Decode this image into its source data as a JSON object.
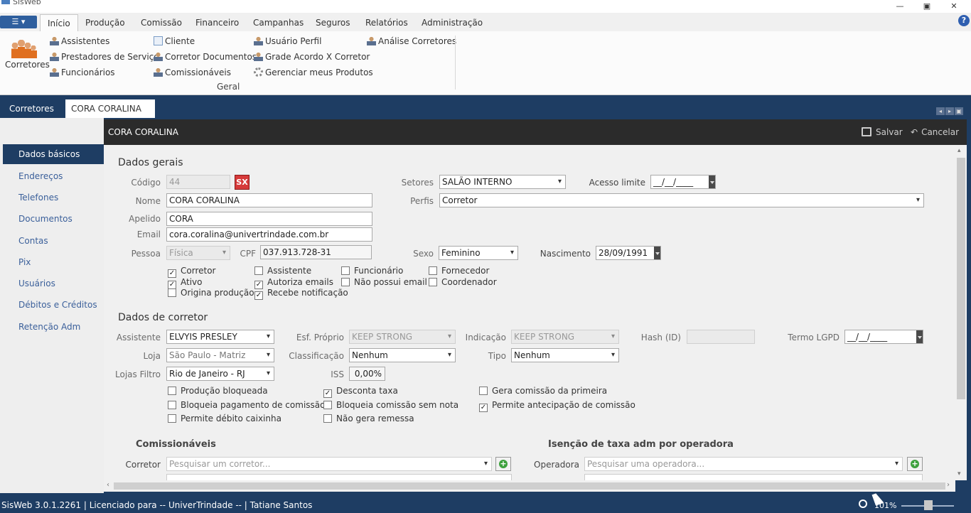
{
  "window": {
    "title": "SisWeb",
    "min": "—",
    "restore": "▣",
    "close": "✕"
  },
  "menu": {
    "app_button": "☰ ▾",
    "tabs": [
      "Início",
      "Produção",
      "Comissão",
      "Financeiro",
      "Campanhas",
      "Seguros",
      "Relatórios",
      "Administração"
    ],
    "help": "?"
  },
  "ribbon": {
    "big": {
      "label": "Corretores"
    },
    "col1": [
      "Assistentes",
      "Prestadores de Serviço",
      "Funcionários"
    ],
    "col2": [
      "Cliente",
      "Corretor Documentos",
      "Comissionáveis"
    ],
    "col3": [
      "Usuário Perfil",
      "Grade Acordo X Corretor",
      "Gerenciar meus Produtos"
    ],
    "col4": [
      "Análise Corretores"
    ],
    "group_label": "Geral"
  },
  "doc_tabs": [
    "Corretores",
    "CORA CORALINA"
  ],
  "sidebar": [
    "Dados básicos",
    "Endereços",
    "Telefones",
    "Documentos",
    "Contas",
    "Pix",
    "Usuários",
    "Débitos e Créditos",
    "Retenção Adm"
  ],
  "header": {
    "title": "CORA CORALINA",
    "save": "Salvar",
    "cancel": "Cancelar"
  },
  "dados_gerais": {
    "title": "Dados gerais",
    "codigo_label": "Código",
    "codigo": "44",
    "sx": "SX",
    "nome_label": "Nome",
    "nome": "CORA CORALINA",
    "apelido_label": "Apelido",
    "apelido": "CORA",
    "email_label": "Email",
    "email": "cora.coralina@univertrindade.com.br",
    "pessoa_label": "Pessoa",
    "pessoa": "Física",
    "cpf_label": "CPF",
    "cpf": "037.913.728-31",
    "setores_label": "Setores",
    "setores": "SALÃO INTERNO",
    "perfis_label": "Perfis",
    "perfis": "Corretor",
    "acesso_label": "Acesso limite",
    "acesso": "__/__/____",
    "sexo_label": "Sexo",
    "sexo": "Feminino",
    "nasc_label": "Nascimento",
    "nasc": "28/09/1991",
    "checks": [
      {
        "label": "Corretor",
        "checked": true
      },
      {
        "label": "Ativo",
        "checked": true
      },
      {
        "label": "Origina produção",
        "checked": false
      },
      {
        "label": "Assistente",
        "checked": false
      },
      {
        "label": "Autoriza emails",
        "checked": true
      },
      {
        "label": "Recebe notificação",
        "checked": true
      },
      {
        "label": "Funcionário",
        "checked": false
      },
      {
        "label": "Não possui email",
        "checked": false
      },
      {
        "label": "Fornecedor",
        "checked": false
      },
      {
        "label": "Coordenador",
        "checked": false
      }
    ]
  },
  "dados_corretor": {
    "title": "Dados de corretor",
    "assistente_label": "Assistente",
    "assistente": "ELVYIS PRESLEY",
    "loja_label": "Loja",
    "loja": "São Paulo - Matriz",
    "lojas_label": "Lojas Filtro",
    "lojas": "Rio de Janeiro - RJ",
    "esf_label": "Esf. Próprio",
    "esf": "KEEP STRONG",
    "class_label": "Classificação",
    "class": "Nenhum",
    "iss_label": "ISS",
    "iss": "0,00%",
    "ind_label": "Indicação",
    "ind": "KEEP STRONG",
    "tipo_label": "Tipo",
    "tipo": "Nenhum",
    "hash_label": "Hash (ID)",
    "hash": "",
    "lgpd_label": "Termo LGPD",
    "lgpd": "__/__/____",
    "checks": [
      {
        "label": "Produção bloqueada",
        "checked": false
      },
      {
        "label": "Bloqueia pagamento de comissão",
        "checked": false
      },
      {
        "label": "Permite débito caixinha",
        "checked": false
      },
      {
        "label": "Desconta taxa",
        "checked": true
      },
      {
        "label": "Bloqueia comissão sem nota",
        "checked": false
      },
      {
        "label": "Não gera remessa",
        "checked": false
      },
      {
        "label": "Gera comissão da primeira",
        "checked": false
      },
      {
        "label": "Permite antecipação de comissão",
        "checked": true
      }
    ]
  },
  "comissionaveis": {
    "title": "Comissionáveis",
    "label": "Corretor",
    "placeholder": "Pesquisar um corretor..."
  },
  "isencao": {
    "title": "Isenção de taxa adm por operadora",
    "label": "Operadora",
    "placeholder": "Pesquisar uma operadora..."
  },
  "status": {
    "text": "SisWeb 3.0.1.2261 | Licenciado para -- UniverTrindade -- | Tatiane Santos",
    "zoom": "101%"
  }
}
